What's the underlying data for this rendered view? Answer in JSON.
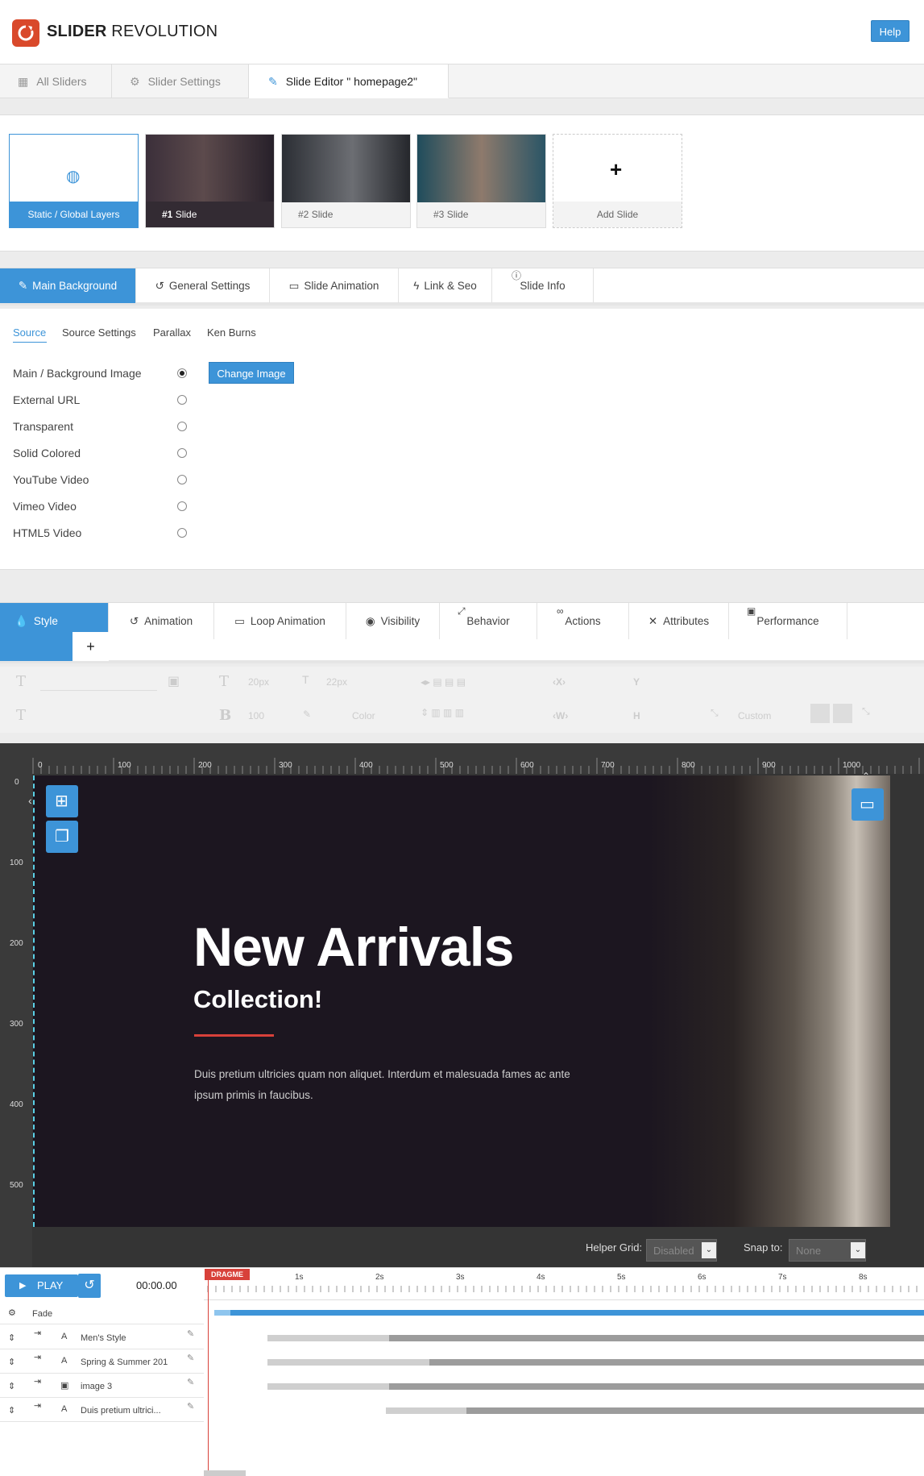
{
  "app": {
    "brand_bold": "SLIDER",
    "brand_rest": " REVOLUTION",
    "help_label": "Help"
  },
  "topnav": [
    {
      "label": "All Sliders",
      "icon": "grid-icon"
    },
    {
      "label": "Slider Settings",
      "icon": "gear-icon"
    },
    {
      "label": "Slide Editor \" homepage2\"",
      "icon": "pencil-icon"
    }
  ],
  "slides": [
    {
      "label": "Static / Global Layers"
    },
    {
      "label": "Slide",
      "num": "#1"
    },
    {
      "label": "Slide",
      "num": "#2"
    },
    {
      "label": "Slide",
      "num": "#3"
    },
    {
      "label": "Add Slide"
    }
  ],
  "main_tabs": [
    "Main Background",
    "General Settings",
    "Slide Animation",
    "Link & Seo",
    "Slide Info"
  ],
  "source_tabs": [
    "Source",
    "Source Settings",
    "Parallax",
    "Ken Burns"
  ],
  "source_options": [
    {
      "label": "Main / Background Image",
      "selected": true
    },
    {
      "label": "External URL",
      "selected": false
    },
    {
      "label": "Transparent",
      "selected": false
    },
    {
      "label": "Solid Colored",
      "selected": false
    },
    {
      "label": "YouTube Video",
      "selected": false
    },
    {
      "label": "Vimeo Video",
      "selected": false
    },
    {
      "label": "HTML5 Video",
      "selected": false
    }
  ],
  "change_image_label": "Change Image",
  "layer_tabs": [
    "Style",
    "Animation",
    "Loop Animation",
    "Visibility",
    "Behavior",
    "Actions",
    "Attributes",
    "Performance"
  ],
  "toolbar": {
    "font_size": "20px",
    "line_height": "22px",
    "font_weight": "100",
    "color_label": "Color",
    "custom_label": "Custom",
    "x_label": "X",
    "y_label": "Y",
    "w_label": "W",
    "h_label": "H"
  },
  "ruler": {
    "top_ticks": [
      "0",
      "100",
      "200",
      "300",
      "400",
      "500",
      "600",
      "700",
      "800",
      "900",
      "1000"
    ],
    "left_ticks": [
      "0",
      "100",
      "200",
      "300",
      "400",
      "500"
    ]
  },
  "slide_content": {
    "headline": "New Arrivals",
    "subheadline": "Collection!",
    "body": "Duis pretium ultricies quam non aliquet. Interdum et malesuada fames ac ante ipsum primis in faucibus."
  },
  "helper": {
    "grid_label": "Helper Grid:",
    "grid_value": "Disabled",
    "snap_label": "Snap to:",
    "snap_value": "None"
  },
  "timeline": {
    "play_label": "PLAY",
    "time": "00:00.00",
    "marker": "DRAGME",
    "seconds": [
      "1s",
      "2s",
      "3s",
      "4s",
      "5s",
      "6s",
      "7s",
      "8s"
    ],
    "transition": "Fade",
    "layers": [
      {
        "name": "Men's Style",
        "type": "text"
      },
      {
        "name": "Spring & Summer 201",
        "type": "text"
      },
      {
        "name": "image 3",
        "type": "image"
      },
      {
        "name": "Duis pretium ultrici...",
        "type": "text"
      }
    ]
  },
  "colors": {
    "accent": "#3d94d8",
    "brand": "#d9492b",
    "red_line": "#d8413a",
    "stage": "#1c1620"
  }
}
